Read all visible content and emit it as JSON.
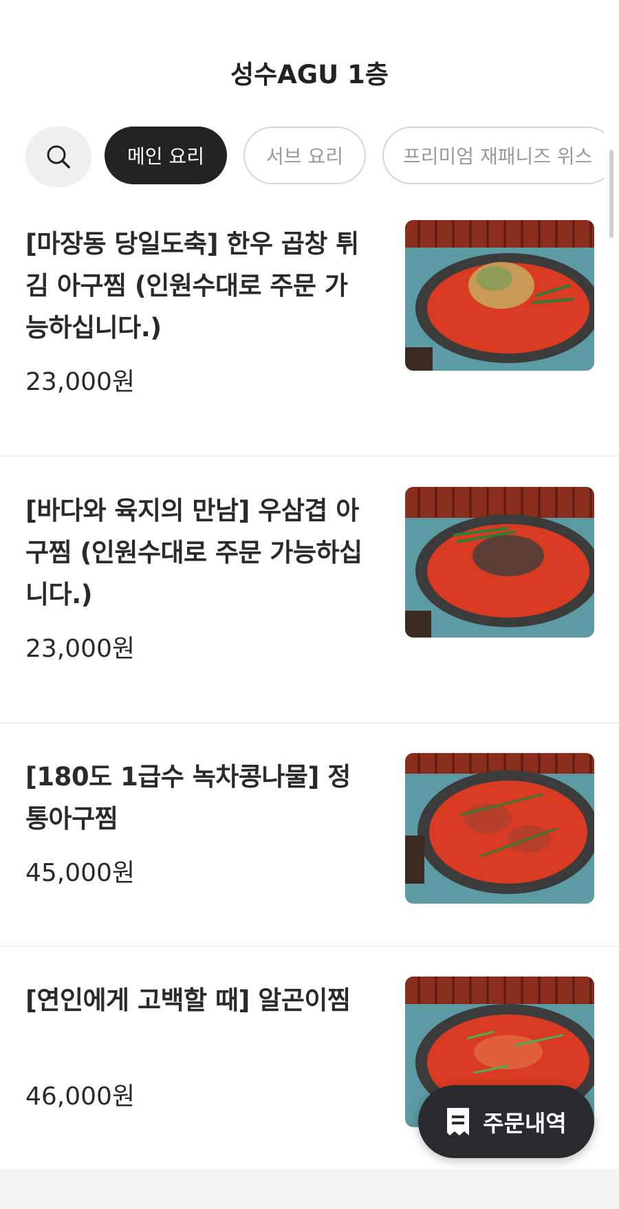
{
  "header": {
    "title": "성수AGU 1층"
  },
  "categories": {
    "search_icon": "search-icon",
    "tabs": [
      {
        "label": "메인 요리",
        "active": true
      },
      {
        "label": "서브 요리",
        "active": false
      },
      {
        "label": "프리미엄 재패니즈 위스",
        "active": false
      }
    ]
  },
  "menu": {
    "items": [
      {
        "name": "[마장동 당일도축] 한우 곱창 튀김 아구찜 (인원수대로 주문 가능하십니다.)",
        "price": "23,000원"
      },
      {
        "name": "[바다와 육지의 만남] 우삼겹 아구찜 (인원수대로 주문 가능하십니다.)",
        "price": "23,000원"
      },
      {
        "name": "[180도 1급수 녹차콩나물] 정통아구찜",
        "price": "45,000원"
      },
      {
        "name": "[연인에게 고백할 때] 알곤이찜",
        "price": "46,000원"
      }
    ]
  },
  "order_button": {
    "label": "주문내역",
    "icon": "receipt-icon"
  },
  "colors": {
    "dark": "#222222",
    "sauce": "#d83a22",
    "pan": "#3b3b3b",
    "table": "#5c9aa4",
    "wood": "#8a2d1d"
  }
}
